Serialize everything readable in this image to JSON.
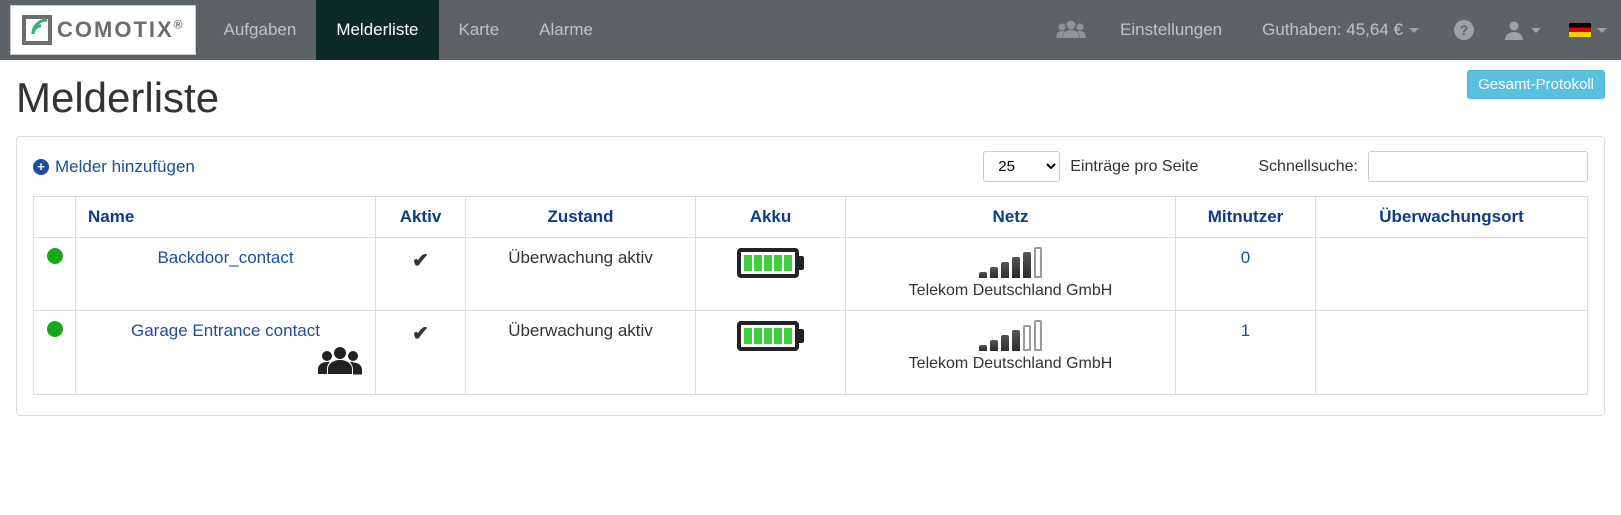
{
  "brand": {
    "name": "COMOTIX",
    "reg": "®"
  },
  "nav": {
    "aufgaben": "Aufgaben",
    "melderliste": "Melderliste",
    "karte": "Karte",
    "alarme": "Alarme",
    "einstellungen": "Einstellungen",
    "guthaben_label": "Guthaben:",
    "guthaben_value": "45,64 €"
  },
  "page": {
    "title": "Melderliste",
    "gesamt_protokoll": "Gesamt-Protokoll",
    "add_melder": "Melder hinzufügen",
    "per_page_label": "Einträge pro Seite",
    "per_page_value": "25",
    "quicksearch_label": "Schnellsuche:",
    "quicksearch_value": ""
  },
  "columns": {
    "name": "Name",
    "aktiv": "Aktiv",
    "zustand": "Zustand",
    "akku": "Akku",
    "netz": "Netz",
    "mitnutzer": "Mitnutzer",
    "ort": "Überwachungsort"
  },
  "rows": [
    {
      "status_color": "#1aa81a",
      "name": "Backdoor_contact",
      "shared": false,
      "aktiv": true,
      "zustand": "Überwachung aktiv",
      "akku_level": 5,
      "signal_bars": 5,
      "provider": "Telekom Deutschland GmbH",
      "mitnutzer": "0",
      "ort": ""
    },
    {
      "status_color": "#1aa81a",
      "name": "Garage Entrance contact",
      "shared": true,
      "aktiv": true,
      "zustand": "Überwachung aktiv",
      "akku_level": 5,
      "signal_bars": 4,
      "provider": "Telekom Deutschland GmbH",
      "mitnutzer": "1",
      "ort": ""
    }
  ]
}
